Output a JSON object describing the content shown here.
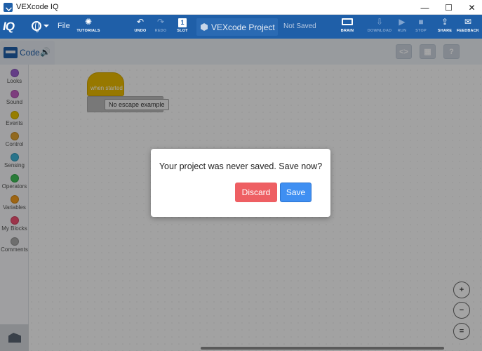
{
  "window": {
    "title": "VEXcode IQ",
    "controls": {
      "minimize": "—",
      "maximize": "☐",
      "close": "✕"
    }
  },
  "menubar": {
    "logo": "IQ",
    "file": "File",
    "tools": {
      "tutorials": "TUTORIALS",
      "undo": "UNDO",
      "redo": "REDO",
      "slot": "SLOT",
      "slot_number": "1",
      "brain": "BRAIN",
      "download": "DOWNLOAD",
      "run": "RUN",
      "stop": "STOP",
      "share": "SHARE",
      "feedback": "FEEDBACK"
    },
    "project_name": "VEXcode Project",
    "save_status": "Not Saved"
  },
  "code_tab": {
    "label": "Code"
  },
  "top_right_buttons": {
    "code_view": "<>",
    "devices": "▦",
    "help": "?"
  },
  "categories": [
    {
      "label": "Looks",
      "color": "#9a5fd0"
    },
    {
      "label": "Sound",
      "color": "#c25fc2"
    },
    {
      "label": "Events",
      "color": "#e8c200"
    },
    {
      "label": "Control",
      "color": "#e0a230"
    },
    {
      "label": "Sensing",
      "color": "#3fb2d6"
    },
    {
      "label": "Operators",
      "color": "#3fbf57"
    },
    {
      "label": "Variables",
      "color": "#f39c1e"
    },
    {
      "label": "My Blocks",
      "color": "#f05072"
    },
    {
      "label": "Comments",
      "color": "#a9a9a9"
    }
  ],
  "blocks": {
    "hat": "when started",
    "command": "No escape example"
  },
  "dialog": {
    "message": "Your project was never saved. Save now?",
    "discard": "Discard",
    "save": "Save"
  },
  "zoom": {
    "in": "+",
    "out": "−",
    "reset": "="
  }
}
